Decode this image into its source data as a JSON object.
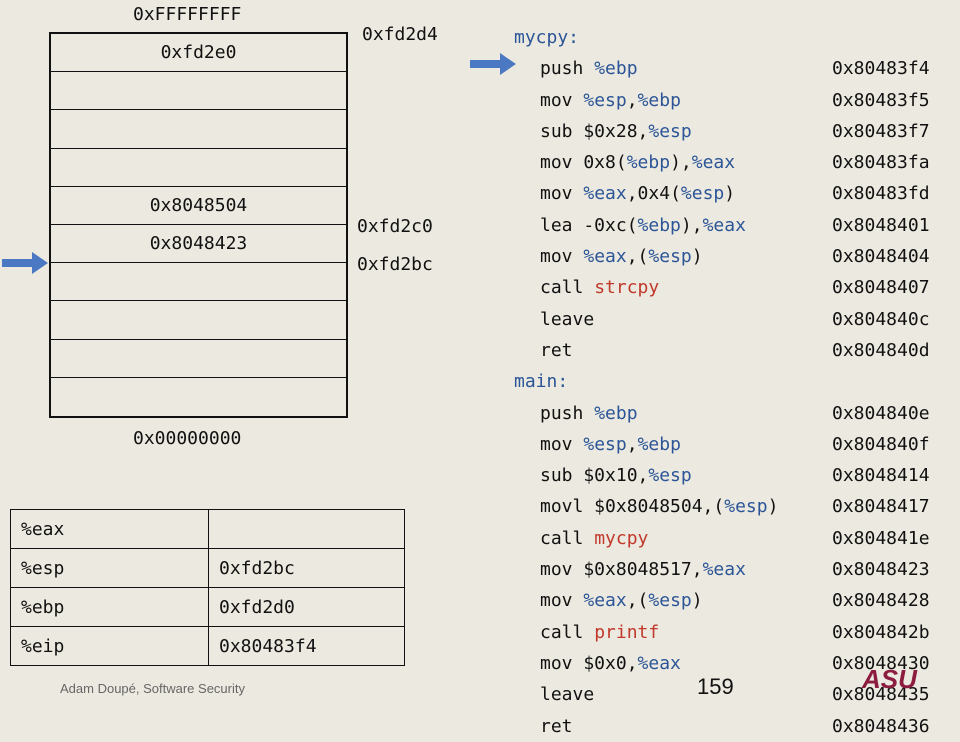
{
  "stack": {
    "top_label": "0xFFFFFFFF",
    "bottom_label": "0x00000000",
    "cells": [
      "0xfd2e0",
      "",
      "",
      "",
      "0x8048504",
      "0x8048423",
      "",
      "",
      "",
      ""
    ],
    "addr_labels": [
      "0xfd2d4",
      "0xfd2c0",
      "0xfd2bc"
    ]
  },
  "registers": [
    {
      "name": "%eax",
      "value": ""
    },
    {
      "name": "%esp",
      "value": "0xfd2bc"
    },
    {
      "name": "%ebp",
      "value": "0xfd2d0"
    },
    {
      "name": "%eip",
      "value": "0x80483f4"
    }
  ],
  "asm": [
    {
      "label": "mycpy:"
    },
    {
      "ins": "push %ebp",
      "addr": "0x80483f4"
    },
    {
      "ins": "mov %esp,%ebp",
      "addr": "0x80483f5"
    },
    {
      "ins": "sub $0x28,%esp",
      "addr": "0x80483f7"
    },
    {
      "ins": "mov 0x8(%ebp),%eax",
      "addr": "0x80483fa"
    },
    {
      "ins": "mov %eax,0x4(%esp)",
      "addr": "0x80483fd"
    },
    {
      "ins": "lea -0xc(%ebp),%eax",
      "addr": "0x8048401"
    },
    {
      "ins": "mov %eax,(%esp)",
      "addr": "0x8048404"
    },
    {
      "ins": "call strcpy",
      "addr": "0x8048407"
    },
    {
      "ins": "leave",
      "addr": "0x804840c"
    },
    {
      "ins": "ret",
      "addr": "0x804840d"
    },
    {
      "label": "main:"
    },
    {
      "ins": "push %ebp",
      "addr": "0x804840e"
    },
    {
      "ins": "mov %esp,%ebp",
      "addr": "0x804840f"
    },
    {
      "ins": "sub $0x10,%esp",
      "addr": "0x8048414"
    },
    {
      "ins": "movl $0x8048504,(%esp)",
      "addr": "0x8048417"
    },
    {
      "ins": "call mycpy",
      "addr": "0x804841e"
    },
    {
      "ins": "mov $0x8048517,%eax",
      "addr": "0x8048423"
    },
    {
      "ins": "mov %eax,(%esp)",
      "addr": "0x8048428"
    },
    {
      "ins": "call printf",
      "addr": "0x804842b"
    },
    {
      "ins": "mov $0x0,%eax",
      "addr": "0x8048430"
    },
    {
      "ins": "leave",
      "addr": "0x8048435"
    },
    {
      "ins": "ret",
      "addr": "0x8048436"
    }
  ],
  "footer": "Adam Doupé, Software Security",
  "page_number": "159",
  "logo_text": "ASU",
  "colors": {
    "register": "#2b5597",
    "function": "#c0392b",
    "arrow": "#4a78c2"
  }
}
